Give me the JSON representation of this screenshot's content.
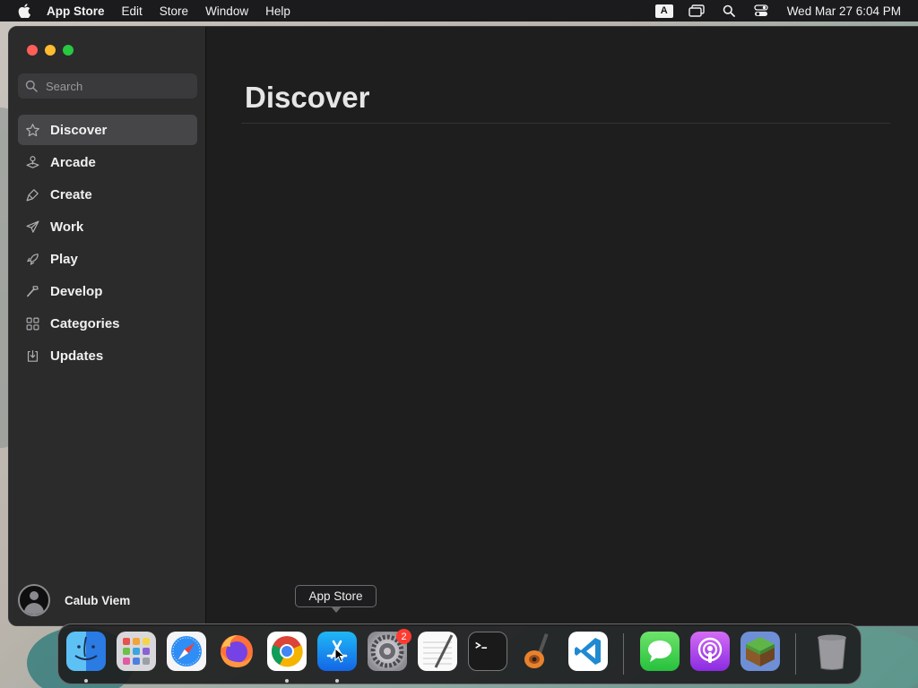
{
  "menubar": {
    "app_name": "App Store",
    "menus": [
      "Edit",
      "Store",
      "Window",
      "Help"
    ],
    "keyboard_indicator": "A",
    "clock": "Wed Mar 27  6:04 PM"
  },
  "sidebar": {
    "search_placeholder": "Search",
    "items": [
      {
        "label": "Discover",
        "icon": "star-icon",
        "active": true
      },
      {
        "label": "Arcade",
        "icon": "joystick-icon"
      },
      {
        "label": "Create",
        "icon": "brush-icon"
      },
      {
        "label": "Work",
        "icon": "paper-plane-icon"
      },
      {
        "label": "Play",
        "icon": "rocket-icon"
      },
      {
        "label": "Develop",
        "icon": "hammer-icon"
      },
      {
        "label": "Categories",
        "icon": "grid-icon"
      },
      {
        "label": "Updates",
        "icon": "download-icon"
      }
    ],
    "user_name": "Calub Viem"
  },
  "main": {
    "title": "Discover"
  },
  "tooltip": {
    "text": "App Store"
  },
  "dock": {
    "apps": [
      {
        "name": "Finder",
        "icon": "finder-icon",
        "running": true
      },
      {
        "name": "Launchpad",
        "icon": "launchpad-icon"
      },
      {
        "name": "Safari",
        "icon": "safari-icon"
      },
      {
        "name": "Firefox",
        "icon": "firefox-icon"
      },
      {
        "name": "Chrome",
        "icon": "chrome-icon",
        "running": true
      },
      {
        "name": "App Store",
        "icon": "app-store-icon",
        "running": true
      },
      {
        "name": "System Settings",
        "icon": "settings-icon",
        "badge": "2"
      },
      {
        "name": "TextEdit",
        "icon": "textedit-icon"
      },
      {
        "name": "Terminal",
        "icon": "terminal-icon"
      },
      {
        "name": "GarageBand",
        "icon": "garageband-icon"
      },
      {
        "name": "VS Code",
        "icon": "vscode-icon"
      },
      {
        "name": "Messages",
        "icon": "messages-icon"
      },
      {
        "name": "Podcasts",
        "icon": "podcasts-icon"
      },
      {
        "name": "Minecraft",
        "icon": "minecraft-icon"
      },
      {
        "name": "Trash",
        "icon": "trash-icon"
      }
    ],
    "settings_badge": "2"
  },
  "colors": {
    "menubar_bg": "#1b1b1d",
    "sidebar_bg": "#2b2b2c",
    "window_bg": "#1e1e1f",
    "active_item_bg": "#464648"
  }
}
